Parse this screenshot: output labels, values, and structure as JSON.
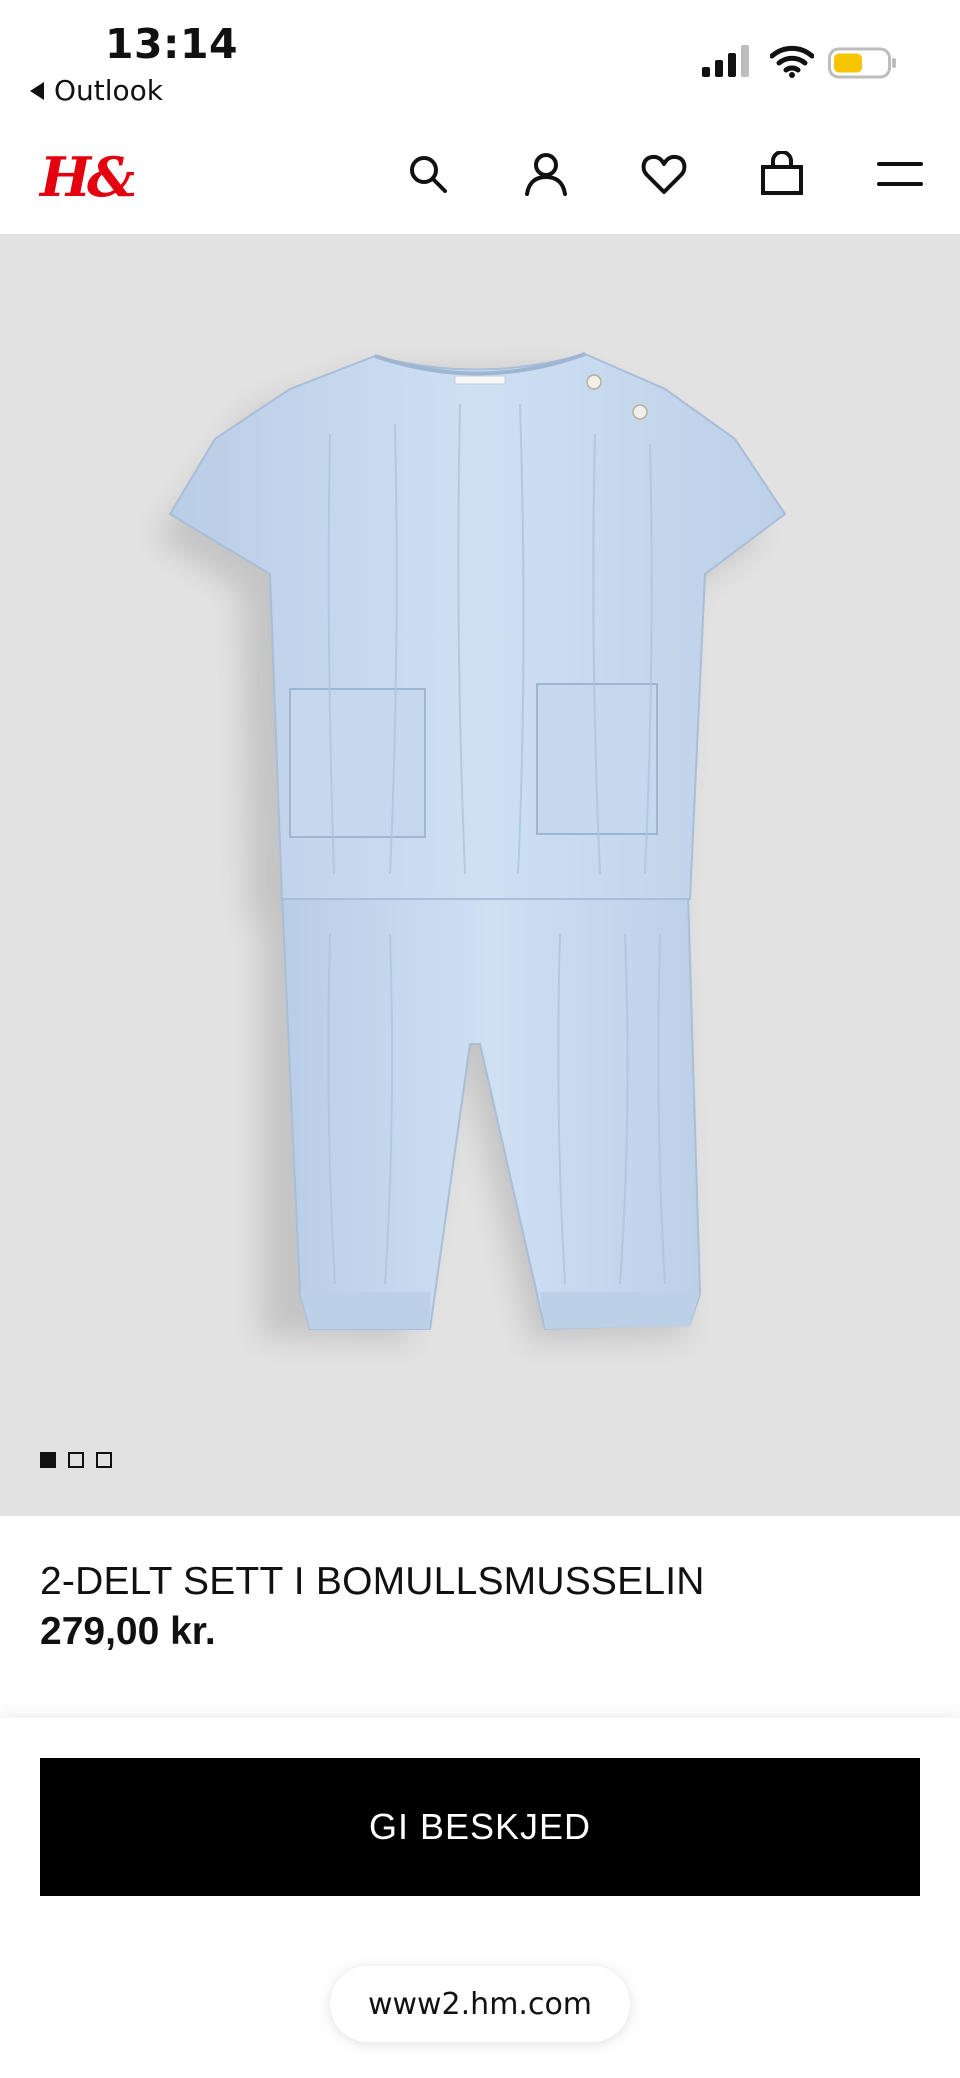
{
  "status_bar": {
    "time": "13:14",
    "back_app": "Outlook",
    "battery_color": "#F7C600"
  },
  "header": {
    "logo_text": "H&M",
    "logo_color": "#E50010",
    "icons": [
      "search-icon",
      "account-icon",
      "favorites-icon",
      "shopping-bag-icon",
      "menu-icon"
    ]
  },
  "gallery": {
    "image_count": 3,
    "active_index": 0
  },
  "product": {
    "name": "2-DELT SETT I BOMULLSMUSSELIN",
    "price": "279,00 kr."
  },
  "cta": {
    "notify_label": "GI BESKJED"
  },
  "browser": {
    "url": "www2.hm.com"
  }
}
